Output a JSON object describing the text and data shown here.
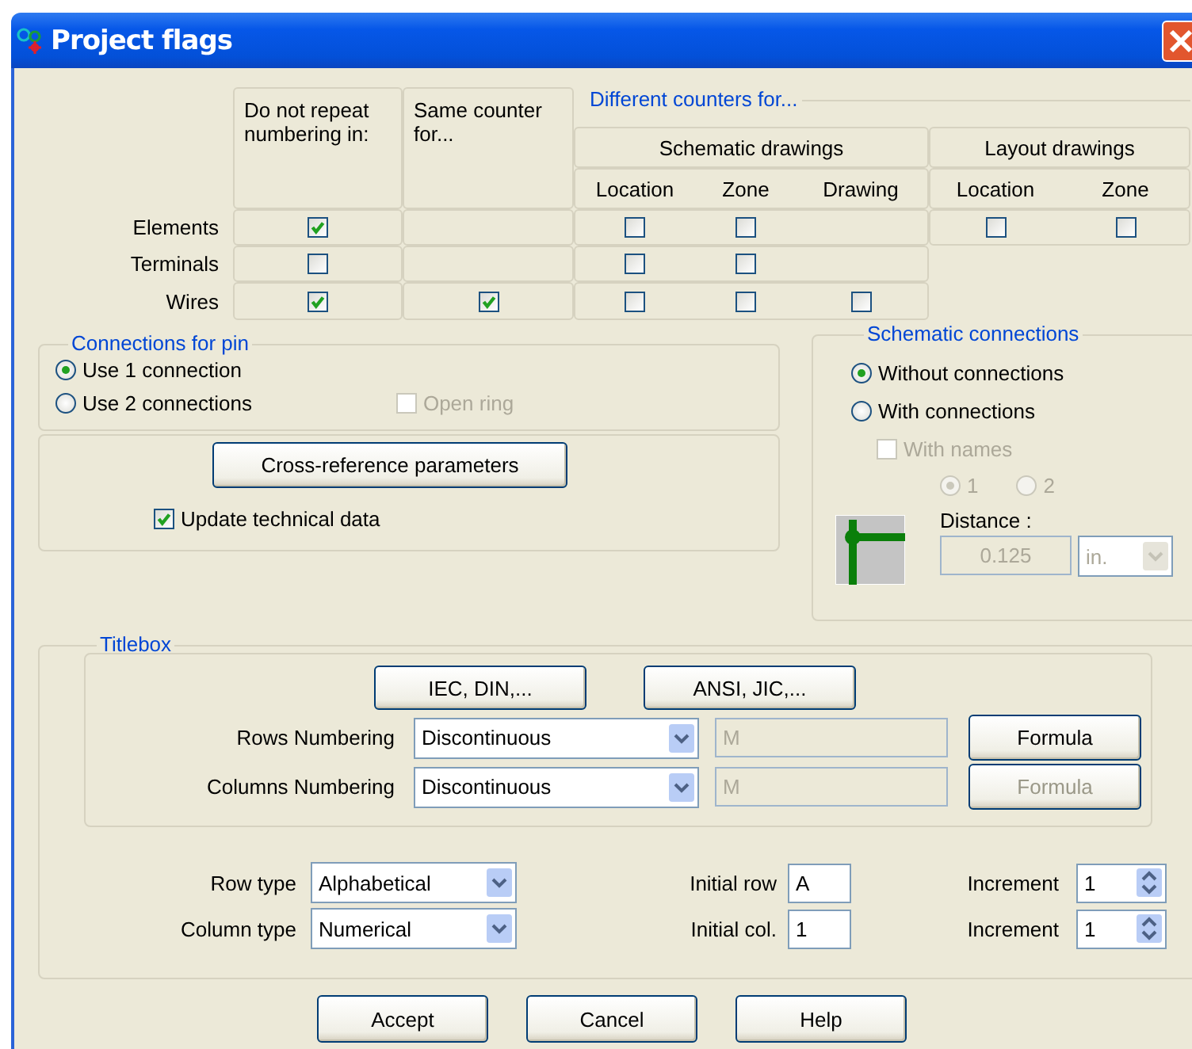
{
  "window": {
    "title": "Project flags"
  },
  "numbering": {
    "do_not_repeat_heading": "Do not repeat numbering in:",
    "same_counter_heading": "Same counter for...",
    "counters_title": "Different counters for...",
    "schematic": {
      "title": "Schematic drawings",
      "columns": [
        "Location",
        "Zone",
        "Drawing"
      ]
    },
    "layout": {
      "title": "Layout drawings",
      "columns": [
        "Location",
        "Zone"
      ]
    },
    "rows": [
      {
        "label": "Elements",
        "do_not_repeat": {
          "checked": true
        },
        "schematic": [
          {
            "checked": false
          },
          {
            "checked": false
          }
        ],
        "layout": [
          {
            "checked": false
          },
          {
            "checked": false
          }
        ]
      },
      {
        "label": "Terminals",
        "do_not_repeat": {
          "checked": false
        },
        "schematic": [
          {
            "checked": false
          },
          {
            "checked": false
          }
        ]
      },
      {
        "label": "Wires",
        "do_not_repeat": {
          "checked": true
        },
        "same_counter": {
          "checked": true
        },
        "schematic": [
          {
            "checked": false
          },
          {
            "checked": false
          },
          {
            "checked": false
          }
        ]
      }
    ]
  },
  "pin_connections": {
    "title": "Connections for pin",
    "options": [
      {
        "label": "Use 1 connection",
        "selected": true
      },
      {
        "label": "Use 2 connections",
        "selected": false
      }
    ],
    "open_ring": {
      "label": "Open ring",
      "checked": false,
      "disabled": true
    }
  },
  "cross_reference_button": "Cross-reference parameters",
  "update_technical_data": {
    "label": "Update technical data",
    "checked": true
  },
  "schematic_connections": {
    "title": "Schematic connections",
    "options": [
      {
        "label": "Without connections",
        "selected": true
      },
      {
        "label": "With connections",
        "selected": false
      }
    ],
    "with_names": {
      "label": "With names",
      "checked": false,
      "disabled": true
    },
    "name_count": [
      {
        "label": "1",
        "selected": true,
        "disabled": true
      },
      {
        "label": "2",
        "selected": false,
        "disabled": true
      }
    ],
    "distance_label": "Distance :",
    "distance": {
      "value": "0.125",
      "disabled": true
    },
    "unit": {
      "value": "in.",
      "disabled": true
    }
  },
  "titlebox": {
    "title": "Titlebox",
    "standards": [
      "IEC, DIN,...",
      "ANSI, JIC,..."
    ],
    "numbering": [
      {
        "label": "Rows Numbering",
        "value": "Discontinuous",
        "field": "M",
        "formula": {
          "label": "Formula",
          "disabled": false
        }
      },
      {
        "label": "Columns Numbering",
        "value": "Discontinuous",
        "field": "M",
        "formula": {
          "label": "Formula",
          "disabled": true
        }
      }
    ],
    "types": [
      {
        "label": "Row type",
        "value": "Alphabetical",
        "initial_label": "Initial row",
        "initial": "A",
        "increment_label": "Increment",
        "increment": "1"
      },
      {
        "label": "Column type",
        "value": "Numerical",
        "initial_label": "Initial col.",
        "initial": "1",
        "increment_label": "Increment",
        "increment": "1"
      }
    ]
  },
  "buttons": [
    "Accept",
    "Cancel",
    "Help"
  ]
}
